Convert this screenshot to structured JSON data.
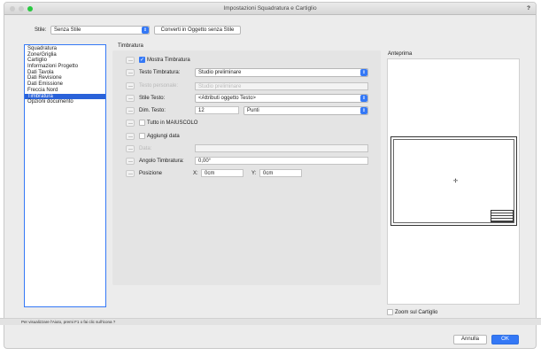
{
  "window": {
    "title": "Impostazioni Squadratura e Cartiglio",
    "help": "?"
  },
  "style": {
    "label": "Stile:",
    "value": "Senza Stile",
    "convert_button": "Converti in Oggetto senza Stile"
  },
  "sidebar": {
    "items": [
      "Squadratura",
      "Zone/Griglia",
      "Cartiglio",
      "Informazioni Progetto",
      "Dati Tavola",
      "Dati Revisione",
      "Dati Emissione",
      "Freccia Nord",
      "Timbratura",
      "Opzioni documento"
    ],
    "selected": "Timbratura"
  },
  "group": {
    "title": "Timbratura"
  },
  "form": {
    "show_stamp": {
      "label": "Mostra Timbratura",
      "checked": true
    },
    "stamp_text": {
      "label": "Testo Timbratura:",
      "value": "Studio preliminare"
    },
    "custom_text": {
      "label": "Testo personale:",
      "value": "Studio preliminare"
    },
    "text_style": {
      "label": "Stile Testo:",
      "value": "<Attributi oggetto Testo>"
    },
    "text_size": {
      "label": "Dim. Testo:",
      "value": "12",
      "unit": "Punti"
    },
    "uppercase": {
      "label": "Tutto in MAIUSCOLO",
      "checked": false
    },
    "add_date": {
      "label": "Aggiungi data",
      "checked": false
    },
    "date": {
      "label": "Data:",
      "value": ""
    },
    "angle": {
      "label": "Angolo Timbratura:",
      "value": "0,00°"
    },
    "position": {
      "label": "Posizione",
      "x_label": "X:",
      "x_value": "0cm",
      "y_label": "Y:",
      "y_value": "0cm"
    }
  },
  "preview": {
    "title": "Anteprima",
    "zoom_label": "Zoom sul Cartiglio",
    "zoom_checked": false
  },
  "status_text": "Per visualizzare l'Aiuto, premi F1 o fai clic sull'icona ?",
  "buttons": {
    "cancel": "Annulla",
    "ok": "OK"
  },
  "colors": {
    "accent": "#3478f6",
    "selection": "#2a62d9"
  }
}
